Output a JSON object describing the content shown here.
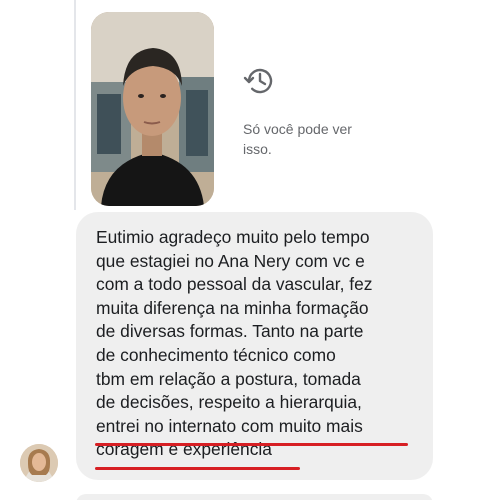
{
  "story_reply": {
    "private_note": "Só você pode ver isso.",
    "history_icon": "history-icon"
  },
  "message": {
    "text": "Eutimio agradeço muito pelo tempo\nque estagiei no Ana Nery com vc e\ncom a todo pessoal da vascular, fez\nmuita diferença na minha formação\nde diversas formas. Tanto na parte\nde conhecimento técnico como\ntbm em relação a postura, tomada\nde decisões, respeito a hierarquia,\nentrei no internato com muito mais\ncoragem e experiência",
    "underline_color": "#d71f24",
    "bubble_color": "#efefef"
  },
  "colors": {
    "text": "#1c1e21",
    "muted": "#65676b"
  }
}
